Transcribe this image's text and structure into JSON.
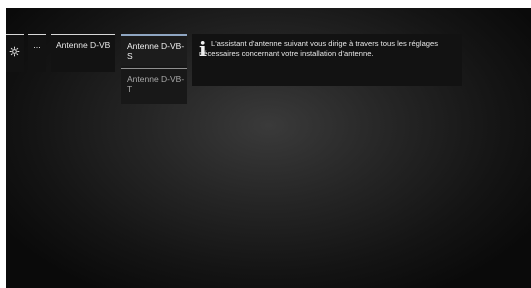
{
  "menu": {
    "settings_icon": "gear-icon",
    "more_label": "...",
    "antenna_label": "Antenne D-VB"
  },
  "submenu": {
    "items": [
      {
        "label": "Antenne D-VB-S",
        "selected": true
      },
      {
        "label": "Antenne D-VB-T",
        "selected": false
      }
    ]
  },
  "info": {
    "icon": "info-icon",
    "icon_glyph": "i",
    "text": "L'assistant d'antenne suivant vous dirige à travers tous les réglages nécessaires concernant votre installation d'antenne."
  },
  "colors": {
    "selected_accent": "#8fa6c2",
    "tile_background": "#121212"
  }
}
